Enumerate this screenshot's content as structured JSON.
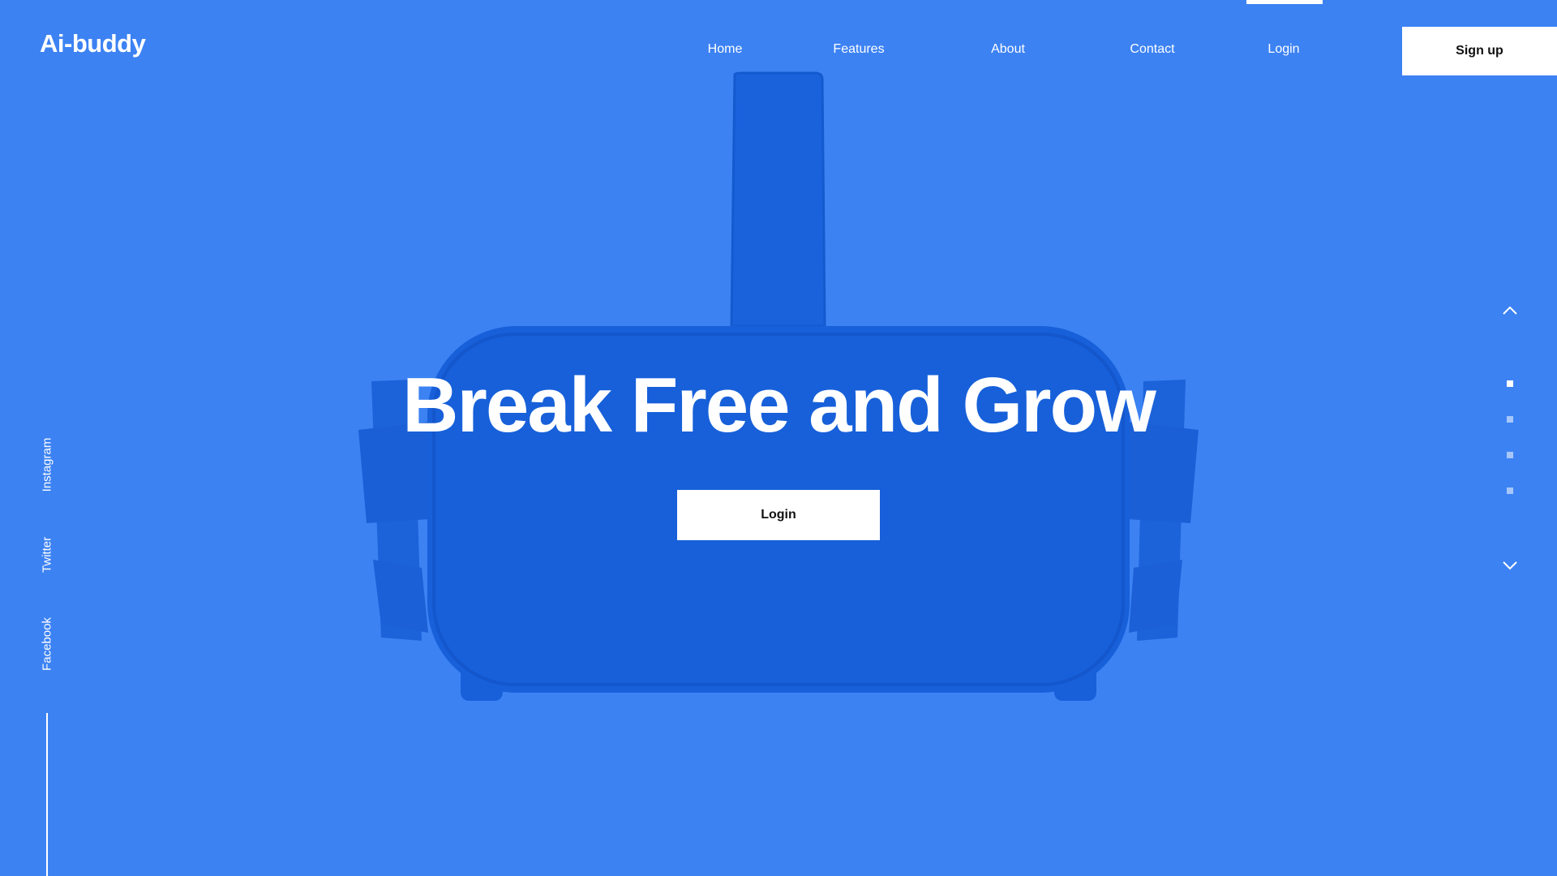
{
  "brand": {
    "name": "Ai-buddy"
  },
  "nav": {
    "items": [
      {
        "label": "Home"
      },
      {
        "label": "Features"
      },
      {
        "label": "About"
      },
      {
        "label": "Contact"
      },
      {
        "label": "Login",
        "active": true
      }
    ],
    "signup_label": "Sign up"
  },
  "hero": {
    "title": "Break Free and Grow",
    "login_label": "Login",
    "image_icon": "vr-headset-icon"
  },
  "social": {
    "items": [
      {
        "label": "Instagram"
      },
      {
        "label": "Twitter"
      },
      {
        "label": "Facebook"
      }
    ]
  },
  "slider": {
    "up_icon": "chevron-up-icon",
    "down_icon": "chevron-down-icon",
    "dot_count": 4,
    "active_dot": 1
  },
  "colors": {
    "background": "#3c82f3",
    "headset": "#1760d9",
    "button_bg": "#ffffff",
    "button_text": "#111111"
  }
}
